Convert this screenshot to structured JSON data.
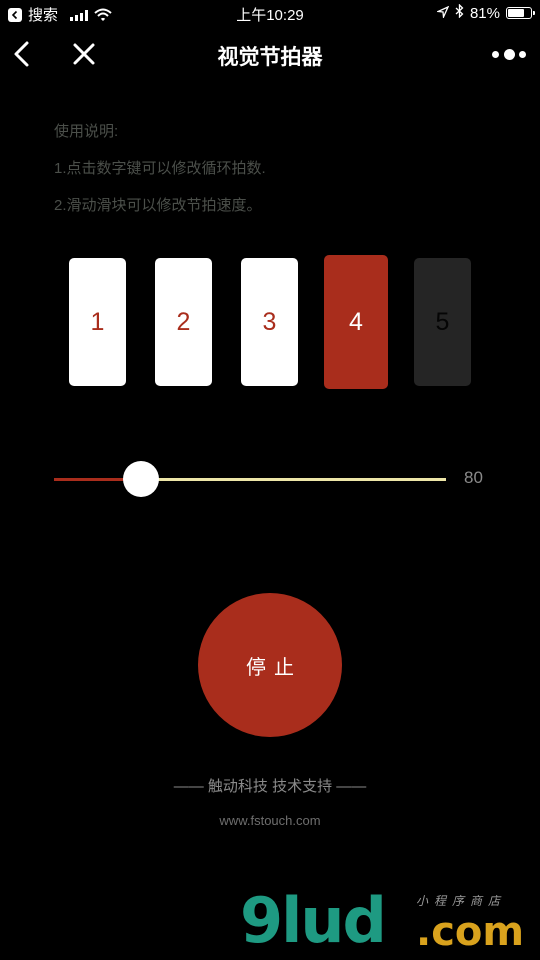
{
  "status_bar": {
    "back_app": "搜索",
    "time": "上午10:29",
    "battery": "81%",
    "battery_level": 0.81
  },
  "nav": {
    "title": "视觉节拍器"
  },
  "instructions": {
    "heading": "使用说明:",
    "line1": "1.点击数字键可以修改循环拍数.",
    "line2": "2.滑动滑块可以修改节拍速度。"
  },
  "beats": [
    "1",
    "2",
    "3",
    "4",
    "5"
  ],
  "slider": {
    "value": "80"
  },
  "stop_button": {
    "label": "停止"
  },
  "footer": {
    "support": "—— 触动科技 技术支持 ——",
    "website": "www.fstouch.com"
  },
  "watermark": {
    "main": "9lud",
    "suffix": ".com",
    "tag": "小程序商店"
  },
  "colors": {
    "accent": "#a92d1c",
    "track_right": "#ede6a8",
    "instruction_text": "#4b4f4a",
    "background": "#000000"
  }
}
